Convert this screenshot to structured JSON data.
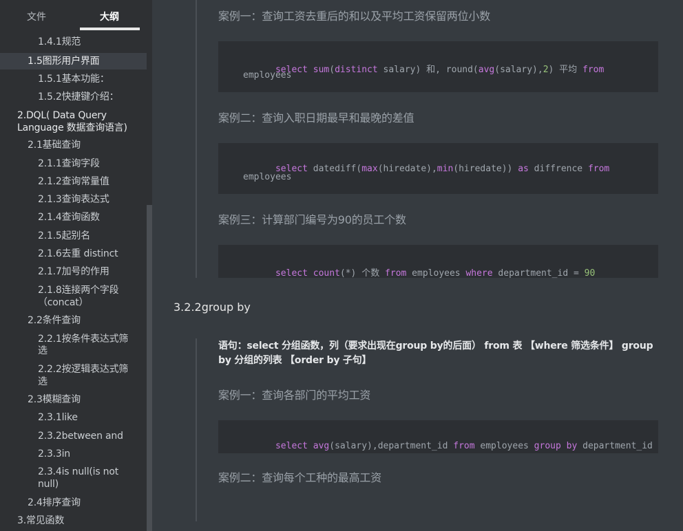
{
  "sidebar": {
    "tabs": {
      "file": "文件",
      "outline": "大纲"
    },
    "items": [
      "1.4.1规范",
      "1.5图形用户界面",
      "1.5.1基本功能：",
      "1.5.2快捷键介绍：",
      "2.DQL( Data Query",
      "Language 数据查询语言)",
      "2.1基础查询",
      "2.1.1查询字段",
      "2.1.2查询常量值",
      "2.1.3查询表达式",
      "2.1.4查询函数",
      "2.1.5起别名",
      "2.1.6去重 distinct",
      "2.1.7加号的作用",
      "2.1.8连接两个字段",
      "（concat）",
      "2.2条件查询",
      "2.2.1按条件表达式筛",
      "选",
      "2.2.2按逻辑表达式筛",
      "选",
      "2.3模糊查询",
      "2.3.1like",
      "2.3.2between and",
      "2.3.3in",
      "2.3.4is null(is not",
      "null)",
      "2.4排序查询",
      "3.常见函数"
    ]
  },
  "content": {
    "case1_title": "案例一：查询工资去重后的和以及平均工资保留两位小数",
    "code1": {
      "l1": [
        "select",
        " ",
        "sum",
        "(",
        "distinct",
        " salary) 和, round(",
        "avg",
        "(salary),",
        "2",
        ") 平均 ",
        "from"
      ],
      "l2": "employees"
    },
    "case2_title": "案例二：查询入职日期最早和最晚的差值",
    "code2": {
      "l1": [
        "select",
        " datediff(",
        "max",
        "(hiredate),",
        "min",
        "(hiredate)) ",
        "as",
        " diffrence ",
        "from"
      ],
      "l2": "employees"
    },
    "case3_title": "案例三：计算部门编号为90的员工个数",
    "code3": {
      "l1": [
        "select",
        " ",
        "count",
        "(*) 个数 ",
        "from",
        " employees ",
        "where",
        " department_id = ",
        "90"
      ]
    },
    "heading": "3.2.2group by",
    "syntax": "语句：select 分组函数，列（要求出现在group by的后面） from 表 【where 筛选条件】 group by 分组的列表 【order by 子句】",
    "case4_title": "案例一：查询各部门的平均工资",
    "code4": {
      "l1": [
        "select",
        " ",
        "avg",
        "(salary),department_id ",
        "from",
        " employees ",
        "group",
        " ",
        "by",
        " department_id"
      ]
    },
    "case5_title": "案例二：查询每个工种的最高工资"
  },
  "colors": {
    "background": "#363b40",
    "sidebar": "#2e3033",
    "code_bg": "#2c2f33",
    "keyword": "#c678dd",
    "number": "#98c379"
  }
}
